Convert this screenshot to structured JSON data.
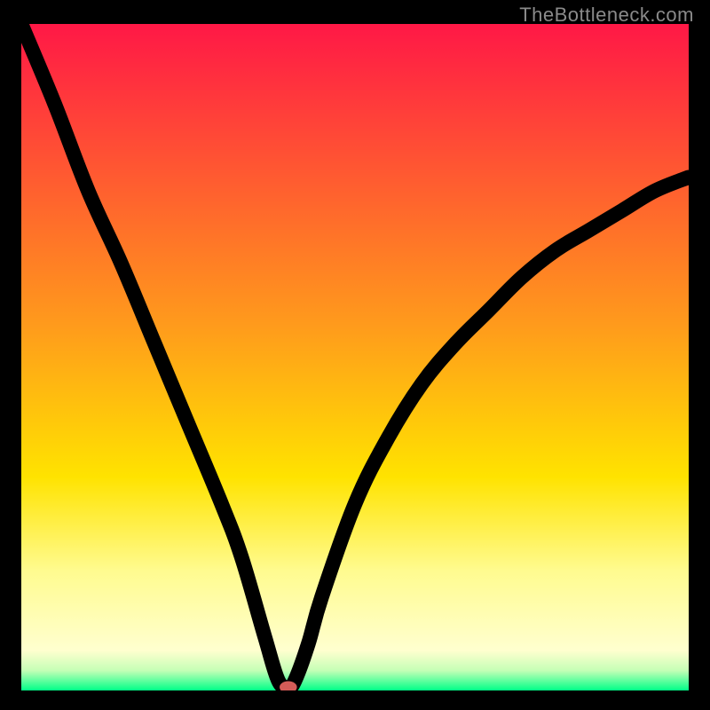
{
  "watermark": "TheBottleneck.com",
  "chart_data": {
    "type": "line",
    "title": "",
    "xlabel": "",
    "ylabel": "",
    "xlim": [
      0,
      100
    ],
    "ylim": [
      0,
      100
    ],
    "gradient_bands": [
      {
        "stop": 0,
        "color": "#ff1846"
      },
      {
        "stop": 45,
        "color": "#ff9a1c"
      },
      {
        "stop": 68,
        "color": "#ffe300"
      },
      {
        "stop": 82,
        "color": "#fffb8f"
      },
      {
        "stop": 94,
        "color": "#ffffcf"
      },
      {
        "stop": 97,
        "color": "#c5ffb6"
      },
      {
        "stop": 100,
        "color": "#00ff88"
      }
    ],
    "series": [
      {
        "name": "bottleneck-curve",
        "x": [
          0,
          5,
          10,
          15,
          20,
          25,
          30,
          33,
          36.5,
          38.5,
          40,
          41,
          43,
          45,
          50,
          55,
          60,
          65,
          70,
          75,
          80,
          85,
          90,
          95,
          100
        ],
        "y": [
          100,
          88,
          75,
          64,
          52,
          40,
          28,
          20,
          8,
          1.5,
          0.5,
          1.5,
          7,
          14,
          28,
          38,
          46,
          52,
          57,
          62,
          66,
          69,
          72,
          75,
          77
        ]
      }
    ],
    "annotations": [
      {
        "name": "minimum-marker",
        "x": 40,
        "y": 0.5,
        "color": "#d45c58"
      }
    ]
  }
}
